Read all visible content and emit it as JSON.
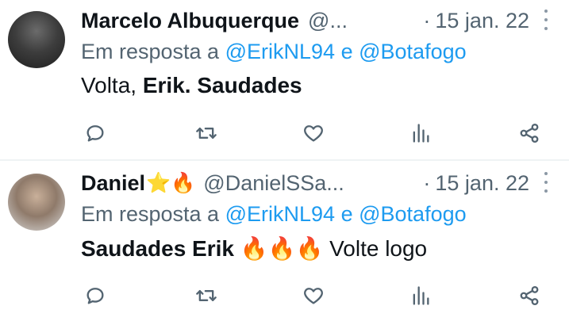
{
  "tweets": [
    {
      "name": "Marcelo Albuquerque",
      "name_emoji": "",
      "handle": "@...",
      "separator": "·",
      "date": "15 jan. 22",
      "reply_prefix": "Em resposta a",
      "mention1": "@ErikNL94",
      "reply_conj": "e",
      "mention2": "@Botafogo",
      "body_plain1": "Volta, ",
      "body_bold1": "Erik. Saudades",
      "body_emoji": "",
      "body_plain2": ""
    },
    {
      "name": "Daniel",
      "name_emoji": "⭐🔥",
      "handle": "@DanielSSa...",
      "separator": "·",
      "date": "15 jan. 22",
      "reply_prefix": "Em resposta a",
      "mention1": "@ErikNL94",
      "reply_conj": "e",
      "mention2": "@Botafogo",
      "body_plain1": "",
      "body_bold1": "Saudades Erik",
      "body_emoji": " 🔥🔥🔥 ",
      "body_plain2": "Volte logo"
    }
  ],
  "icons": {
    "reply": "reply-icon",
    "retweet": "retweet-icon",
    "like": "heart-icon",
    "views": "views-icon",
    "share": "share-icon",
    "more": "more-icon"
  },
  "colors": {
    "text": "#0f1419",
    "secondary": "#536471",
    "link": "#1d9bf0",
    "divider": "#eff3f4"
  }
}
